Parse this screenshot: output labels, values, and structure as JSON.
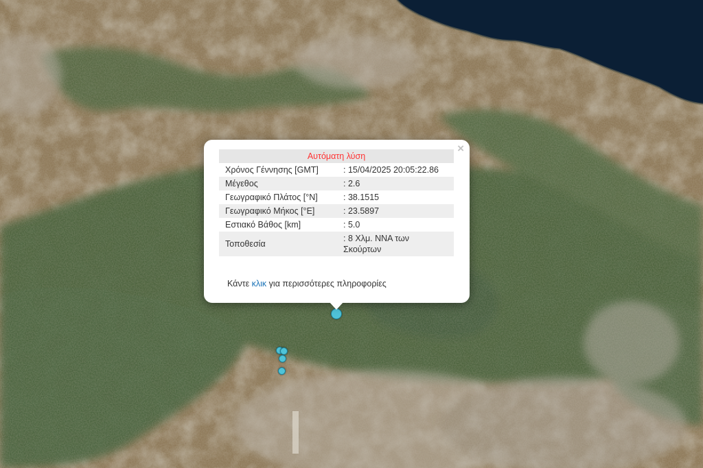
{
  "popup": {
    "title": "Αυτόματη λύση",
    "rows": [
      {
        "label": "Χρόνος Γέννησης [GMT]",
        "value": ": 15/04/2025 20:05:22.86"
      },
      {
        "label": "Μέγεθος",
        "value": ": 2.6"
      },
      {
        "label": "Γεωγραφικό Πλάτος [°N]",
        "value": ": 38.1515"
      },
      {
        "label": "Γεωγραφικό Μήκος [°E]",
        "value": ": 23.5897"
      },
      {
        "label": "Εστιακό Βάθος [km]",
        "value": ": 5.0"
      },
      {
        "label": "Τοποθεσία",
        "value": ": 8 Χλμ. ΝΝΑ των Σκούρτων"
      }
    ],
    "more_prefix": "Κάντε ",
    "more_link": "κλικ",
    "more_suffix": " για περισσότερες πληροφορίες",
    "close_glyph": "×"
  },
  "colors": {
    "sea": "#0b1f35",
    "marker": "#4fc3d8",
    "title_red": "#ff3333",
    "link_blue": "#1a73b8"
  },
  "markers": [
    {
      "name": "selected-earthquake-marker",
      "selected": true
    },
    {
      "name": "earthquake-marker"
    },
    {
      "name": "earthquake-marker"
    },
    {
      "name": "earthquake-marker"
    },
    {
      "name": "earthquake-marker"
    }
  ]
}
